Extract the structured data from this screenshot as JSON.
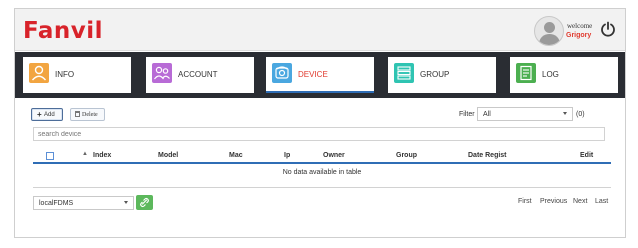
{
  "header": {
    "logo": "Fanvil",
    "welcome": "welcome",
    "username": "Grigory"
  },
  "nav": {
    "tabs": [
      {
        "label": "INFO",
        "icon": "info-user-icon",
        "color": "#f2a541"
      },
      {
        "label": "ACCOUNT",
        "icon": "account-group-icon",
        "color": "#b86bd6"
      },
      {
        "label": "DEVICE",
        "icon": "device-phone-icon",
        "color": "#4aa7e0",
        "active": true
      },
      {
        "label": "GROUP",
        "icon": "group-list-icon",
        "color": "#2fc4b2"
      },
      {
        "label": "LOG",
        "icon": "log-document-icon",
        "color": "#4caf50"
      }
    ]
  },
  "toolbar": {
    "add_label": "Add",
    "delete_label": "Delete",
    "filter_label": "Filter",
    "filter_value": "All",
    "count": "(0)"
  },
  "search": {
    "placeholder": "search device"
  },
  "table": {
    "columns": [
      "Index",
      "Model",
      "Mac",
      "Ip",
      "Owner",
      "Group",
      "Date Regist",
      "Edit"
    ],
    "empty_message": "No data available in table"
  },
  "footer": {
    "source_select": "localFDMS",
    "pager": [
      "First",
      "Previous",
      "Next",
      "Last"
    ]
  },
  "colors": {
    "brand": "#d8232a",
    "accent": "#2f6db5",
    "nav_bg": "#2a2d33",
    "link_button": "#5cb85c"
  }
}
